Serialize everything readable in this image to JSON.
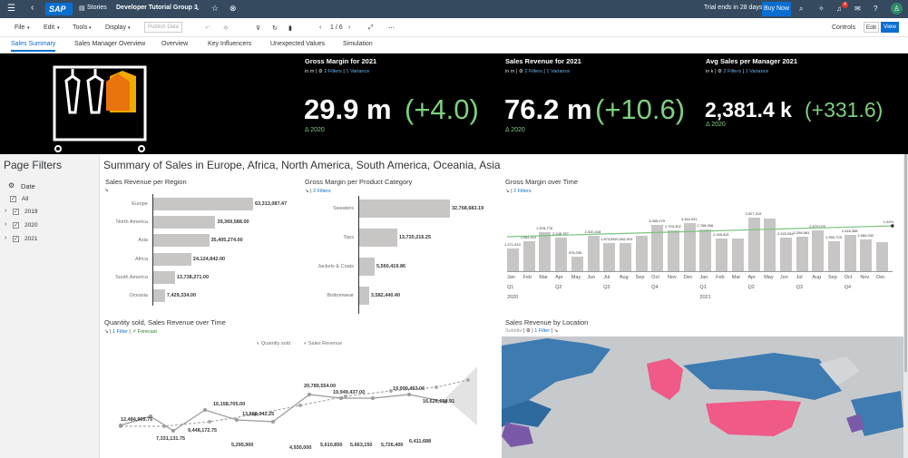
{
  "shell": {
    "logo": "SAP",
    "app": "Stories",
    "story_title": "Developer Tutorial Group 3",
    "trial_text": "Trial ends in 28 days",
    "buy_label": "Buy Now",
    "notification_count": "4",
    "brand_color": "#354a5f",
    "accent_color": "#0a6ed1"
  },
  "menu": {
    "file": "File",
    "edit": "Edit",
    "tools": "Tools",
    "display": "Display",
    "publish": "Publish Data",
    "page_indicator": "1 / 6",
    "controls": "Controls",
    "edit_btn": "Edit",
    "view_btn": "View"
  },
  "tabs": [
    "Sales Summary",
    "Sales Manager Overview",
    "Overview",
    "Key Influencers",
    "Unexpected Values",
    "Simulation"
  ],
  "hero": {
    "kpis": [
      {
        "title": "Gross Margin for 2021",
        "unit": "in m",
        "filters": "2 Filters",
        "variance": "1 Variance",
        "value": "29.9 m",
        "delta": "(+4.0)",
        "year": "Δ 2020"
      },
      {
        "title": "Sales Revenue for 2021",
        "unit": "in m",
        "filters": "2 Filters",
        "variance": "1 Variance",
        "value": "76.2 m",
        "delta": "(+10.6)",
        "year": "Δ 2020"
      },
      {
        "title": "Avg Sales per Manager 2021",
        "unit": "in k",
        "filters": "2 Filters",
        "variance": "1 Variance",
        "value": "2,381.4 k",
        "delta": "(+331.6)",
        "year": "Δ 2020"
      }
    ]
  },
  "filters": {
    "title": "Page Filters",
    "dimension": "Date",
    "all": "All",
    "years": [
      "2019",
      "2020",
      "2021"
    ]
  },
  "main_title": "Summary of Sales in Europe, Africa, North America, South America, Oceania, Asia",
  "chart_data": [
    {
      "type": "bar",
      "title": "Sales Revenue per Region",
      "categories": [
        "Europe",
        "North America",
        "Asia",
        "Africa",
        "South America",
        "Oceania"
      ],
      "values": [
        63313087.47,
        39369588.0,
        35405274.0,
        24124842.0,
        13738271.0,
        7429334.0
      ],
      "labels": [
        "63,313,087.47",
        "39,369,588.00",
        "35,405,274.00",
        "24,124,842.00",
        "13,738,271.00",
        "7,429,334.00"
      ]
    },
    {
      "type": "bar",
      "title": "Gross Margin per Product Category",
      "filter": "2 Filters",
      "categories": [
        "Sweaters",
        "Tops",
        "Jackets & Coats",
        "Bottomwear"
      ],
      "values": [
        32768683.19,
        13720216.25,
        5560419.86,
        3582440.4
      ],
      "labels": [
        "32,768,683.19",
        "13,720,216.25",
        "5,560,419.86",
        "3,582,440.40"
      ]
    },
    {
      "type": "bar",
      "title": "Gross Margin over Time",
      "filter": "2 Filters",
      "categories": [
        "Jan",
        "Feb",
        "Mar",
        "Apr",
        "May",
        "Jun",
        "Jul",
        "Aug",
        "Sep",
        "Oct",
        "Nov",
        "Dec",
        "Jan",
        "Feb",
        "Mar",
        "Apr",
        "May",
        "Jun",
        "Jul",
        "Aug",
        "Sep",
        "Oct",
        "Nov",
        "Dec"
      ],
      "quarters": [
        "Q1",
        "Q2",
        "Q3",
        "Q4",
        "Q1",
        "Q2",
        "Q3",
        "Q4"
      ],
      "years": [
        "2020",
        "2021"
      ],
      "values": [
        1471910,
        1981411,
        2578776,
        2248357,
        976035,
        2310418,
        1873852,
        1862901,
        2328118,
        3065279,
        2703302,
        3154931,
        2768266,
        2169821,
        2189821,
        3527315,
        3510000,
        2243264,
        2298981,
        2670020,
        1950725,
        2418288,
        2084032,
        1920000
      ],
      "labels": [
        "1,471,910",
        "1,981,411",
        "2,578,776",
        "2,248,357",
        "976,035",
        "2,310,418",
        "1,873,852",
        "1,862,901",
        "",
        "3,065,279",
        "2,703,302",
        "3,154,931",
        "2,768,266",
        "2,169,821",
        "",
        "3,527,315",
        "",
        "2,243,264",
        "2,298,981",
        "2,670,020",
        "1,950,725",
        "2,418,288",
        "2,084,032",
        ""
      ],
      "trend_end_label": "1,92%"
    },
    {
      "type": "line",
      "title": "Quantity sold, Sales Revenue over Time",
      "filter": "1 Filter",
      "forecast": "Forecast",
      "legend": [
        "Quantity sold",
        "Sales Revenue"
      ],
      "series": [
        {
          "name": "Sales Revenue",
          "labels": [
            "12,484,965.75",
            "7,331,131.75",
            "9,448,172.75",
            "16,158,705.00",
            "13,868,042.25",
            "",
            "20,789,554.00",
            "19,949,437.00",
            "19,999,453.06",
            "16,626,659.91"
          ]
        },
        {
          "name": "Quantity sold",
          "labels": [
            "",
            "",
            "",
            "5,295,900",
            "",
            "4,930,000",
            "5,610,850",
            "5,663,150",
            "5,726,400",
            "6,411,688"
          ]
        }
      ]
    }
  ],
  "map": {
    "title": "Sales Revenue by Location",
    "subtitle": "Subtitle",
    "filter": "1 Filter"
  }
}
